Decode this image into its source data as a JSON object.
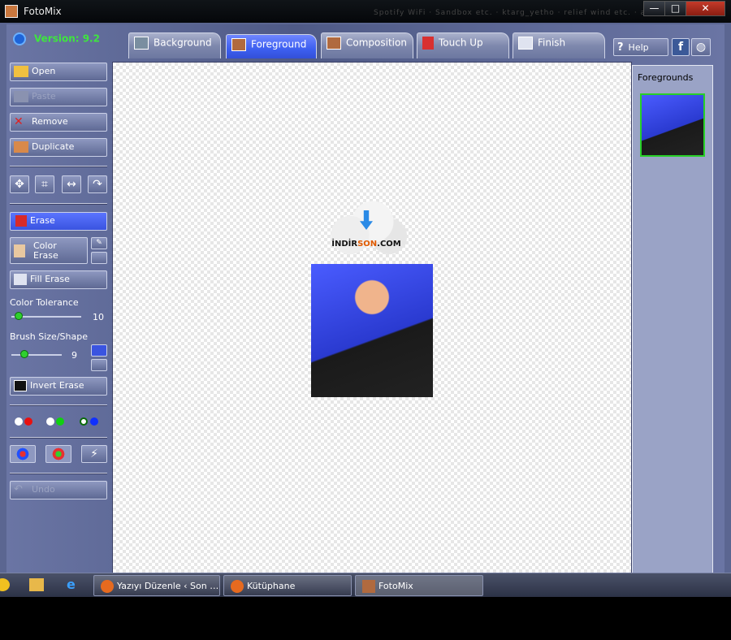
{
  "window": {
    "title": "FotoMix",
    "blurred_title_text": "Spotify WiFi · Sandbox etc. · ktarg_yetho · relief wind etc. · aa yal kol ·",
    "controls": {
      "minimize": "—",
      "maximize": "□",
      "close": "✕"
    }
  },
  "version": "Version: 9.2",
  "tabs": [
    {
      "label": "Background",
      "active": false
    },
    {
      "label": "Foreground",
      "active": true
    },
    {
      "label": "Composition",
      "active": false
    },
    {
      "label": "Touch Up",
      "active": false
    },
    {
      "label": "Finish",
      "active": false
    }
  ],
  "help": {
    "label": "Help",
    "icon": "question-icon"
  },
  "facebook_icon": "facebook-icon",
  "web_icon": "globe-icon",
  "sidebar": {
    "open": "Open",
    "paste": "Paste",
    "remove": "Remove",
    "duplicate": "Duplicate",
    "tools": [
      {
        "icon": "move-icon",
        "glyph": "✥"
      },
      {
        "icon": "crop-icon",
        "glyph": "⌗"
      },
      {
        "icon": "flip-icon",
        "glyph": "↔"
      },
      {
        "icon": "rotate-icon",
        "glyph": "↷"
      }
    ],
    "erase": "Erase",
    "color_erase_line1": "Color",
    "color_erase_line2": "Erase",
    "fill_erase": "Fill Erase",
    "color_tolerance": {
      "label": "Color Tolerance",
      "value": "10",
      "fraction": 0.1
    },
    "brush": {
      "label": "Brush Size/Shape",
      "value": "9",
      "fraction": 0.25
    },
    "invert_erase": "Invert Erase",
    "color_pairs": [
      [
        "#ffffff",
        "#e81010"
      ],
      [
        "#ffffff",
        "#10d010"
      ],
      [
        "#ffffff",
        "#1030ff"
      ]
    ],
    "color_tools": [
      {
        "icon": "color-wheel-icon"
      },
      {
        "icon": "color-picker-icon"
      },
      {
        "icon": "magic-wand-icon"
      }
    ],
    "undo": "Undo"
  },
  "watermark": {
    "part1": "İNDİR",
    "part2": "SON",
    "part3": ".COM"
  },
  "right_panel": {
    "title": "Foregrounds"
  },
  "taskbar": {
    "items": [
      {
        "label": "Yazıyı Düzenle ‹ Son …",
        "color": "#e66a1f"
      },
      {
        "label": "Kütüphane",
        "color": "#e66a1f"
      },
      {
        "label": "FotoMix",
        "color": "#b06a3f"
      }
    ]
  }
}
